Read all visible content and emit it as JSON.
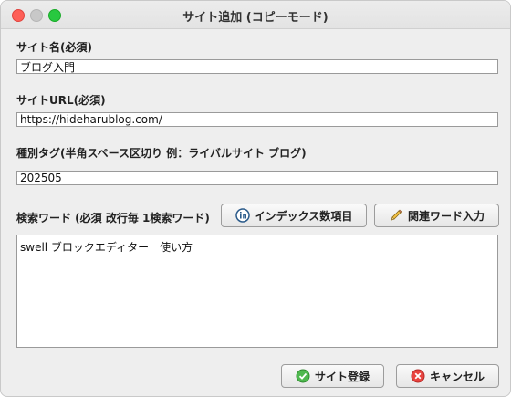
{
  "window": {
    "title": "サイト追加 (コピーモード)"
  },
  "site_name": {
    "label": "サイト名(必須)",
    "value": "ブログ入門"
  },
  "site_url": {
    "label": "サイトURL(必須)",
    "value": "https://hideharublog.com/"
  },
  "tags": {
    "label": "種別タグ(半角スペース区切り 例：ライバルサイト ブログ)",
    "value": "202505"
  },
  "keywords": {
    "label": "検索ワード (必須 改行毎 1検索ワード)",
    "value": "swell ブロックエディター　使い方",
    "index_button": "インデックス数項目",
    "related_button": "関連ワード入力"
  },
  "footer": {
    "register_button": "サイト登録",
    "cancel_button": "キャンセル"
  },
  "colors": {
    "accent_green": "#3aa53a",
    "cancel_red": "#e03a3a",
    "index_blue": "#2a5a8a"
  }
}
